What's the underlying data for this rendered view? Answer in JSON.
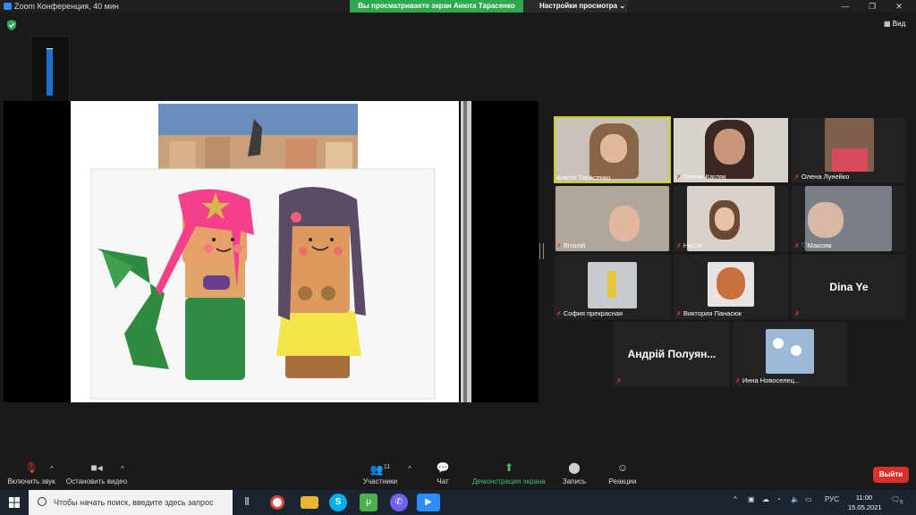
{
  "window": {
    "title": "Zoom Конференция, 40 мин",
    "banner": "Вы просматриваете экран Анюта Тарасенко",
    "view_options": "Настройки просмотра",
    "view_options_caret": "⌄",
    "minimize": "—",
    "maximize": "❐",
    "close": "✕"
  },
  "view_button": "Вид",
  "zoom_level": {
    "value": "98",
    "fill_fraction": 0.98
  },
  "participants": [
    {
      "name": "Анюта Тарасенко",
      "muted": false,
      "active": true
    },
    {
      "name": "Олена Кагляк",
      "muted": true
    },
    {
      "name": "Олена Лунейко",
      "muted": true
    },
    {
      "name": "Віталій",
      "muted": true
    },
    {
      "name": "Настя",
      "muted": true
    },
    {
      "name": "Максим",
      "muted": true,
      "heart": "♡"
    },
    {
      "name": "София прекрасная",
      "muted": true
    },
    {
      "name": "Виктория Панасюк",
      "muted": true
    },
    {
      "name": "",
      "muted": true,
      "label": "Dina Ye"
    },
    {
      "name": "",
      "muted": true,
      "label": "Андрій Полуян..."
    },
    {
      "name": "Инна Новоселец...",
      "muted": true
    }
  ],
  "toolbar": {
    "unmute": "Включить звук",
    "stop_video": "Остановить видео",
    "participants": "Участники",
    "participants_count": "11",
    "chat": "Чат",
    "share_screen": "Демонстрация экрана",
    "record": "Запись",
    "reactions": "Реакции",
    "leave": "Выйти",
    "caret": "^"
  },
  "taskbar": {
    "search_placeholder": "Чтобы начать поиск, введите здесь запрос",
    "lang": "РУС",
    "time": "11:00",
    "date": "15.05.2021",
    "notif_count": "5",
    "tray_caret": "^"
  },
  "colors": {
    "accent_green": "#2fa84f",
    "leave_red": "#d9302b",
    "active_yellow": "#c9d11b",
    "mic_red": "#e0402e"
  }
}
